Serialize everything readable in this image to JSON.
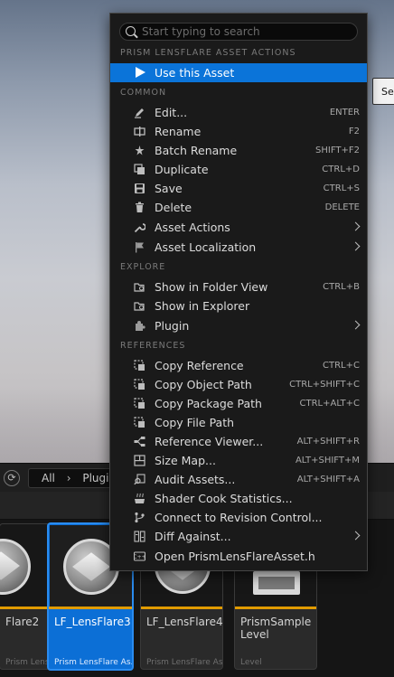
{
  "menu": {
    "search_placeholder": "Start typing to search",
    "sections": {
      "asset_actions": "PRISM LENSFLARE ASSET ACTIONS",
      "common": "COMMON",
      "explore": "EXPLORE",
      "references": "REFERENCES"
    },
    "use_asset": "Use this Asset",
    "items": {
      "edit": {
        "label": "Edit...",
        "shortcut": "ENTER"
      },
      "rename": {
        "label": "Rename",
        "shortcut": "F2"
      },
      "batch_rename": {
        "label": "Batch Rename",
        "shortcut": "SHIFT+F2"
      },
      "duplicate": {
        "label": "Duplicate",
        "shortcut": "CTRL+D"
      },
      "save": {
        "label": "Save",
        "shortcut": "CTRL+S"
      },
      "delete": {
        "label": "Delete",
        "shortcut": "DELETE"
      },
      "asset_actions": {
        "label": "Asset Actions"
      },
      "asset_localization": {
        "label": "Asset Localization"
      },
      "show_folder": {
        "label": "Show in Folder View",
        "shortcut": "CTRL+B"
      },
      "show_explorer": {
        "label": "Show in Explorer"
      },
      "plugin": {
        "label": "Plugin"
      },
      "copy_reference": {
        "label": "Copy Reference",
        "shortcut": "CTRL+C"
      },
      "copy_object_path": {
        "label": "Copy Object Path",
        "shortcut": "CTRL+SHIFT+C"
      },
      "copy_package_path": {
        "label": "Copy Package Path",
        "shortcut": "CTRL+ALT+C"
      },
      "copy_file_path": {
        "label": "Copy File Path"
      },
      "reference_viewer": {
        "label": "Reference Viewer...",
        "shortcut": "ALT+SHIFT+R"
      },
      "size_map": {
        "label": "Size Map...",
        "shortcut": "ALT+SHIFT+M"
      },
      "audit_assets": {
        "label": "Audit Assets...",
        "shortcut": "ALT+SHIFT+A"
      },
      "shader_cook": {
        "label": "Shader Cook Statistics..."
      },
      "revision_control": {
        "label": "Connect to Revision Control..."
      },
      "diff_against": {
        "label": "Diff Against..."
      },
      "open_header": {
        "label": "Open PrismLensFlareAsset.h"
      }
    }
  },
  "tooltip": {
    "text": "Set"
  },
  "content_browser": {
    "path": [
      "All",
      "Plugi"
    ],
    "assets": [
      {
        "name": "Flare2",
        "type": "Prism LensFlare As..."
      },
      {
        "name": "LF_LensFlare3",
        "type": "Prism LensFlare As..."
      },
      {
        "name": "LF_LensFlare4",
        "type": "Prism LensFlare As..."
      },
      {
        "name": "PrismSample\nLevel",
        "type": "Level"
      }
    ]
  },
  "colors": {
    "highlight": "#0b74d9",
    "asset_bar": "#e19b00",
    "selected_tile": "#0c6fd6"
  }
}
